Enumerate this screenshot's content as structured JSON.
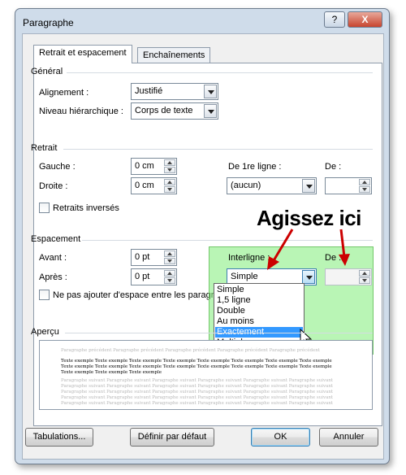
{
  "dialog": {
    "title": "Paragraphe",
    "help_glyph": "?",
    "close_glyph": "X"
  },
  "tabs": [
    {
      "label": "Retrait et espacement",
      "active": true
    },
    {
      "label": "Enchaînements",
      "active": false
    }
  ],
  "general": {
    "heading": "Général",
    "alignment_label": "Alignement :",
    "alignment_value": "Justifié",
    "outline_label": "Niveau hiérarchique :",
    "outline_value": "Corps de texte"
  },
  "indent": {
    "heading": "Retrait",
    "left_label": "Gauche :",
    "left_value": "0 cm",
    "right_label": "Droite :",
    "right_value": "0 cm",
    "first_line_label": "De 1re ligne :",
    "first_line_value": "(aucun)",
    "by_label": "De :",
    "by_value": "",
    "mirror_label": "Retraits inversés"
  },
  "spacing": {
    "heading": "Espacement",
    "before_label": "Avant :",
    "before_value": "0 pt",
    "after_label": "Après :",
    "after_value": "0 pt",
    "line_spacing_label": "Interligne :",
    "line_spacing_value": "Simple",
    "at_label": "De :",
    "at_value": "",
    "no_space_label": "Ne pas ajouter d'espace entre les paragraph",
    "options": [
      "Simple",
      "1,5 ligne",
      "Double",
      "Au moins",
      "Exactement",
      "Multiple"
    ],
    "highlighted_option": "Exactement"
  },
  "preview": {
    "heading": "Aperçu",
    "prev_text": "Paragraphe précédent Paragraphe précédent Paragraphe précédent Paragraphe précédent Paragraphe précédent",
    "sample_text": "Texte exemple Texte exemple Texte exemple Texte exemple Texte exemple Texte exemple Texte exemple Texte exemple",
    "sample_end": "Texte exemple Texte exemple Texte exemple",
    "next_text": "Paragraphe suivant Paragraphe suivant Paragraphe suivant Paragraphe suivant Paragraphe suivant Paragraphe suivant"
  },
  "buttons": {
    "tabs": "Tabulations...",
    "set_default": "Définir par défaut",
    "ok": "OK",
    "cancel": "Annuler"
  },
  "annotation": {
    "text": "Agissez ici",
    "color": "#cc0000",
    "highlight_color": "#80ec78"
  }
}
